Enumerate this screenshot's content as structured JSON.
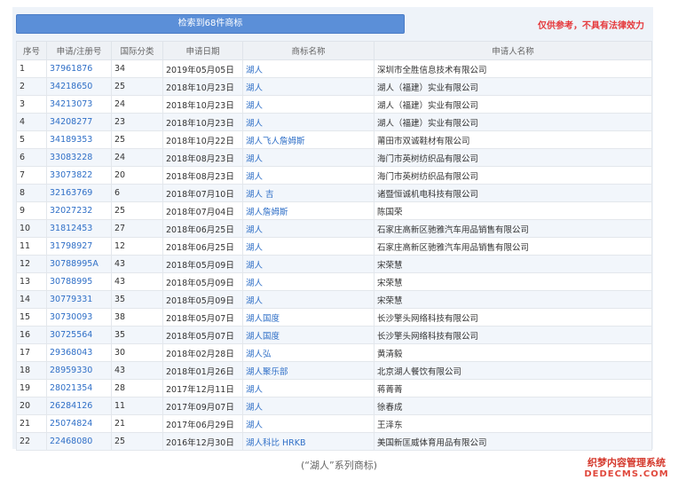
{
  "header": {
    "search_result": "检索到68件商标",
    "disclaimer": "仅供参考，不具有法律效力"
  },
  "columns": [
    "序号",
    "申请/注册号",
    "国际分类",
    "申请日期",
    "商标名称",
    "申请人名称"
  ],
  "rows": [
    [
      "1",
      "37961876",
      "34",
      "2019年05月05日",
      "湖人",
      "深圳市全胜信息技术有限公司"
    ],
    [
      "2",
      "34218650",
      "25",
      "2018年10月23日",
      "湖人",
      "湖人（福建）实业有限公司"
    ],
    [
      "3",
      "34213073",
      "24",
      "2018年10月23日",
      "湖人",
      "湖人（福建）实业有限公司"
    ],
    [
      "4",
      "34208277",
      "23",
      "2018年10月23日",
      "湖人",
      "湖人（福建）实业有限公司"
    ],
    [
      "5",
      "34189353",
      "25",
      "2018年10月22日",
      "湖人飞人詹姆斯",
      "莆田市双诚鞋材有限公司"
    ],
    [
      "6",
      "33083228",
      "24",
      "2018年08月23日",
      "湖人",
      "海门市英树纺织品有限公司"
    ],
    [
      "7",
      "33073822",
      "20",
      "2018年08月23日",
      "湖人",
      "海门市英树纺织品有限公司"
    ],
    [
      "8",
      "32163769",
      "6",
      "2018年07月10日",
      "湖人 吉",
      "诸暨恒诚机电科技有限公司"
    ],
    [
      "9",
      "32027232",
      "25",
      "2018年07月04日",
      "湖人詹姆斯",
      "陈国荣"
    ],
    [
      "10",
      "31812453",
      "27",
      "2018年06月25日",
      "湖人",
      "石家庄高新区驰雅汽车用品销售有限公司"
    ],
    [
      "11",
      "31798927",
      "12",
      "2018年06月25日",
      "湖人",
      "石家庄高新区驰雅汽车用品销售有限公司"
    ],
    [
      "12",
      "30788995A",
      "43",
      "2018年05月09日",
      "湖人",
      "宋荣慧"
    ],
    [
      "13",
      "30788995",
      "43",
      "2018年05月09日",
      "湖人",
      "宋荣慧"
    ],
    [
      "14",
      "30779331",
      "35",
      "2018年05月09日",
      "湖人",
      "宋荣慧"
    ],
    [
      "15",
      "30730093",
      "38",
      "2018年05月07日",
      "湖人国度",
      "长沙擎头网络科技有限公司"
    ],
    [
      "16",
      "30725564",
      "35",
      "2018年05月07日",
      "湖人国度",
      "长沙擎头网络科技有限公司"
    ],
    [
      "17",
      "29368043",
      "30",
      "2018年02月28日",
      "湖人弘",
      "黄清毅"
    ],
    [
      "18",
      "28959330",
      "43",
      "2018年01月26日",
      "湖人聚乐部",
      "北京湖人餐饮有限公司"
    ],
    [
      "19",
      "28021354",
      "28",
      "2017年12月11日",
      "湖人",
      "蒋菁菁"
    ],
    [
      "20",
      "26284126",
      "11",
      "2017年09月07日",
      "湖人",
      "徐春成"
    ],
    [
      "21",
      "25074824",
      "21",
      "2017年06月29日",
      "湖人",
      "王泽东"
    ],
    [
      "22",
      "22468080",
      "25",
      "2016年12月30日",
      "湖人科比 HRKB",
      "美国新匡威体育用品有限公司"
    ]
  ],
  "caption": "(“湖人”系列商标)",
  "watermark": {
    "line1": "织梦内容管理系统",
    "line2": "DEDECMS.COM"
  }
}
